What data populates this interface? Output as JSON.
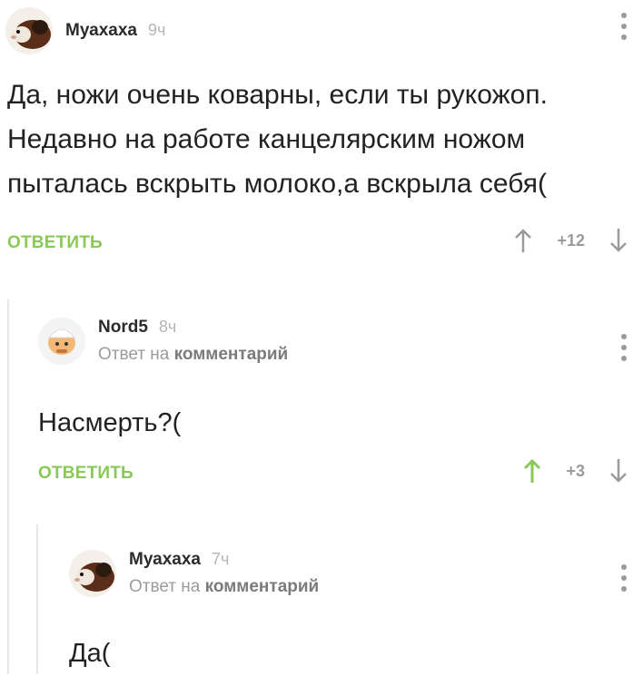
{
  "colors": {
    "accent_green": "#8ac858",
    "muted_gray": "#9b9b9b",
    "thread_line": "#e6e6e6"
  },
  "comments": [
    {
      "username": "Муахаха",
      "time": "9ч",
      "text_lines": [
        "Да, ножи очень коварны, если ты рукожоп.",
        "Недавно на работе канцелярским ножом",
        "пыталась вскрыть молоко,а вскрыла себя("
      ],
      "reply_label": "ОТВЕТИТЬ",
      "score": "+12",
      "upvoted": false,
      "avatar_icon": "guinea-pig-avatar"
    },
    {
      "username": "Nord5",
      "time": "8ч",
      "reply_prefix": "Ответ на",
      "reply_target": "комментарий",
      "text": "Насмерть?(",
      "reply_label": "ОТВЕТИТЬ",
      "score": "+3",
      "upvoted": true,
      "avatar_icon": "cartoon-avatar"
    },
    {
      "username": "Муахаха",
      "time": "7ч",
      "reply_prefix": "Ответ на",
      "reply_target": "комментарий",
      "text": "Да(",
      "avatar_icon": "guinea-pig-avatar"
    }
  ]
}
